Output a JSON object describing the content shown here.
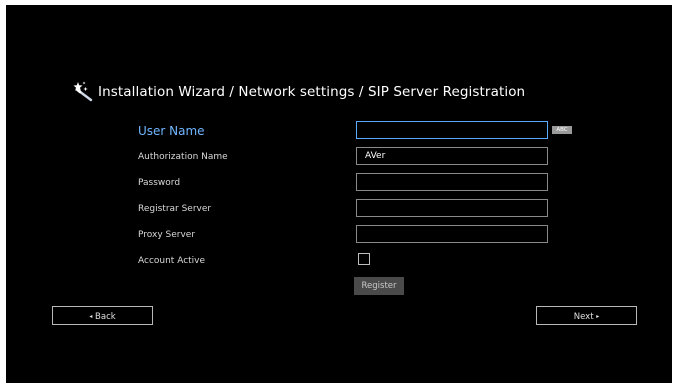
{
  "title": "Installation Wizard / Network settings / SIP Server Registration",
  "form": {
    "user_name": {
      "label": "User Name",
      "value": "",
      "keyboard_mode": "ABC"
    },
    "authorization_name": {
      "label": "Authorization Name",
      "value": "AVer"
    },
    "password": {
      "label": "Password",
      "value": ""
    },
    "registrar_server": {
      "label": "Registrar Server",
      "value": ""
    },
    "proxy_server": {
      "label": "Proxy Server",
      "value": ""
    },
    "account_active": {
      "label": "Account Active",
      "checked": false
    },
    "register_label": "Register"
  },
  "nav": {
    "back_arrow": "◂",
    "back_label": "Back",
    "next_label": "Next",
    "next_arrow": "▸"
  },
  "icons": {
    "title_icon": "wizard-wand-icon"
  },
  "colors": {
    "background": "#000000",
    "active_label": "#6fb6ff",
    "active_border": "#5aa9ff",
    "register_button": "#4a4a4a"
  }
}
